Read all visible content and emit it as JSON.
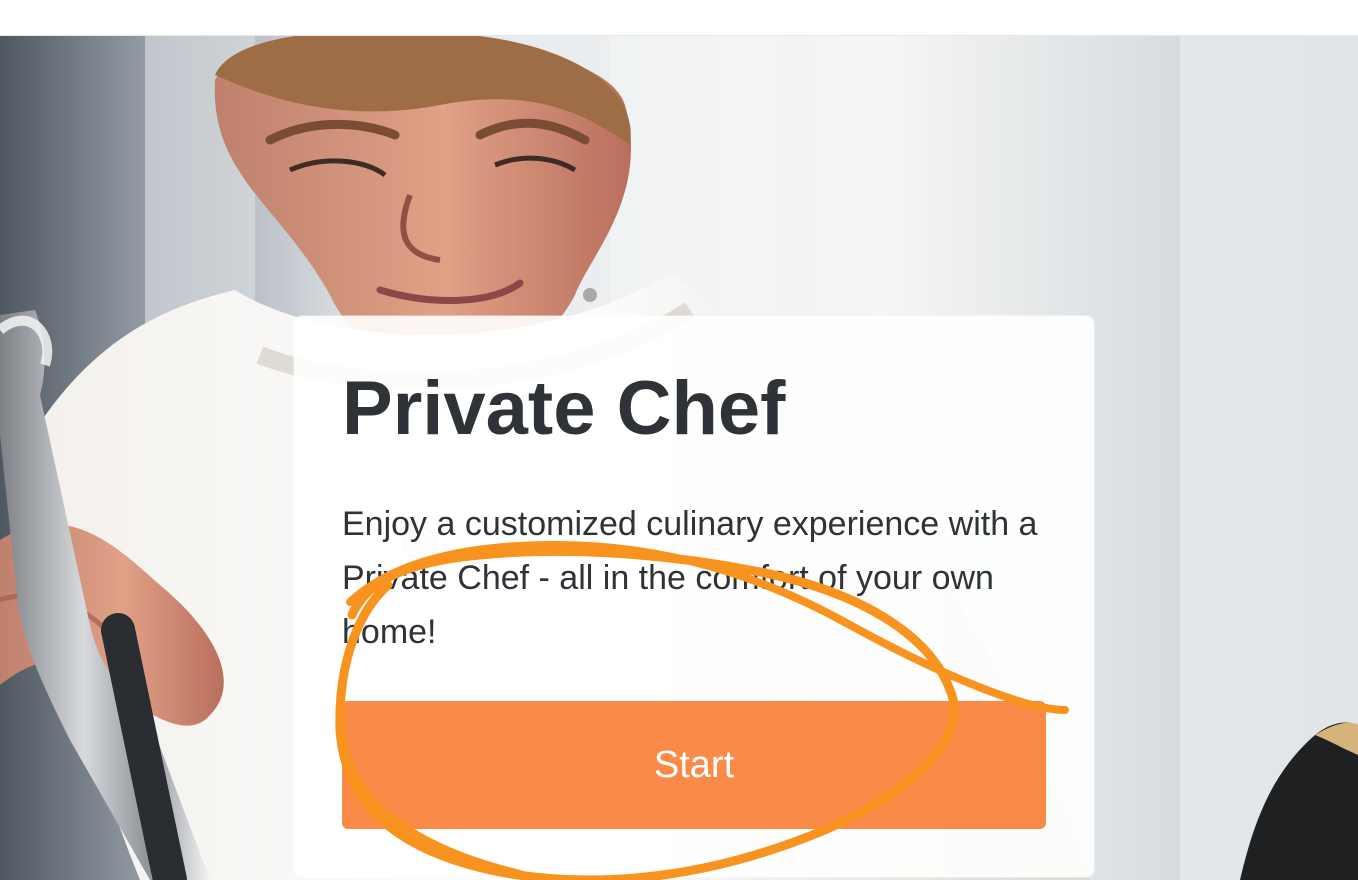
{
  "hero": {
    "title": "Private Chef",
    "description": "Enjoy a customized culinary experience with a Private Chef - all in the comfort of your own home!",
    "button": {
      "label": "Start"
    }
  },
  "colors": {
    "primary_button": "#fa8a47",
    "annotation_stroke": "#f7931e",
    "title_text": "#2f3337"
  },
  "imagery": {
    "hero_subject": "chef-background-photo",
    "annotation": "orange-hand-drawn-ring"
  }
}
